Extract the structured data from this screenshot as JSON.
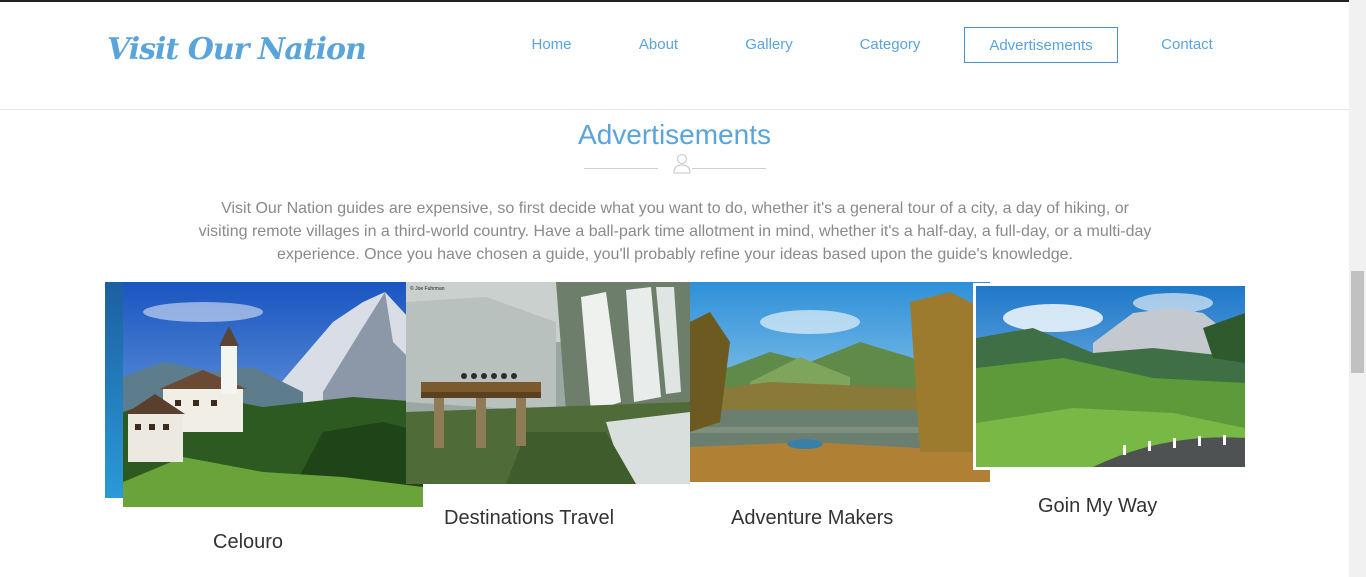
{
  "site": {
    "logo": "Visit Our Nation"
  },
  "nav": {
    "items": [
      {
        "label": "Home",
        "active": false
      },
      {
        "label": "About",
        "active": false
      },
      {
        "label": "Gallery",
        "active": false
      },
      {
        "label": "Category",
        "active": false
      },
      {
        "label": "Advertisements",
        "active": true
      },
      {
        "label": "Contact",
        "active": false
      }
    ]
  },
  "section": {
    "title": "Advertisements",
    "description": "Visit Our Nation guides are expensive, so first decide what you want to do, whether it's a general tour of a city, a day of hiking, or visiting remote villages in a third-world country. Have a ball-park time allotment in mind, whether it's a half-day, a full-day, or a multi-day experience. Once you have chosen a guide, you'll probably refine your ideas based upon the guide's knowledge."
  },
  "cards": [
    {
      "label": "Celouro",
      "image": "alpine-village-photo"
    },
    {
      "label": "Destinations Travel",
      "image": "waterfall-viewpoint-photo",
      "credit": "© Joe Fuhrman"
    },
    {
      "label": "Adventure Makers",
      "image": "lake-hills-photo"
    },
    {
      "label": "Goin My Way",
      "image": "tea-hills-road-photo"
    }
  ],
  "colors": {
    "accent": "#5aa4dc",
    "text": "#333333",
    "muted": "#8a8a8a"
  }
}
